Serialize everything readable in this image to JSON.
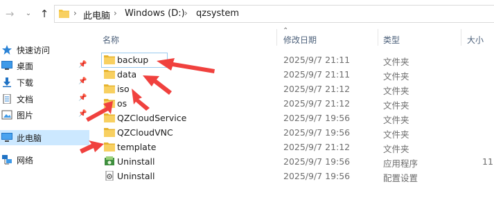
{
  "address": {
    "crumbs": [
      "此电脑",
      "Windows (D:)",
      "qzsystem"
    ]
  },
  "nav": {
    "items": [
      {
        "label": "快速访问",
        "icon": "star-icon",
        "pin": false
      },
      {
        "label": "桌面",
        "icon": "desktop-icon",
        "pin": true
      },
      {
        "label": "下载",
        "icon": "download-icon",
        "pin": true
      },
      {
        "label": "文档",
        "icon": "document-icon",
        "pin": true
      },
      {
        "label": "图片",
        "icon": "picture-icon",
        "pin": true
      },
      {
        "label": "此电脑",
        "icon": "computer-icon",
        "pin": false,
        "selected": true
      },
      {
        "label": "网络",
        "icon": "network-icon",
        "pin": false
      }
    ]
  },
  "columns": {
    "name": "名称",
    "date": "修改日期",
    "type": "类型",
    "size": "大小"
  },
  "files": [
    {
      "name": "backup",
      "date": "2025/9/7 21:11",
      "type": "文件夹",
      "size": "",
      "icon": "folder-icon"
    },
    {
      "name": "data",
      "date": "2025/9/7 21:11",
      "type": "文件夹",
      "size": "",
      "icon": "folder-icon"
    },
    {
      "name": "iso",
      "date": "2025/9/7 21:12",
      "type": "文件夹",
      "size": "",
      "icon": "folder-icon"
    },
    {
      "name": "os",
      "date": "2025/9/7 21:12",
      "type": "文件夹",
      "size": "",
      "icon": "folder-icon"
    },
    {
      "name": "QZCloudService",
      "date": "2025/9/7 19:56",
      "type": "文件夹",
      "size": "",
      "icon": "folder-icon"
    },
    {
      "name": "QZCloudVNC",
      "date": "2025/9/7 19:56",
      "type": "文件夹",
      "size": "",
      "icon": "folder-icon"
    },
    {
      "name": "template",
      "date": "2025/9/7 21:12",
      "type": "文件夹",
      "size": "",
      "icon": "folder-icon"
    },
    {
      "name": "Uninstall",
      "date": "2025/9/7 19:56",
      "type": "应用程序",
      "size": "11",
      "icon": "uninstall-app-icon"
    },
    {
      "name": "Uninstall",
      "date": "2025/9/7 19:56",
      "type": "配置设置",
      "size": "",
      "icon": "config-file-icon"
    }
  ],
  "colors": {
    "folder": "#f4c542",
    "annotation": "#f0413e",
    "selection": "#cce8ff"
  }
}
